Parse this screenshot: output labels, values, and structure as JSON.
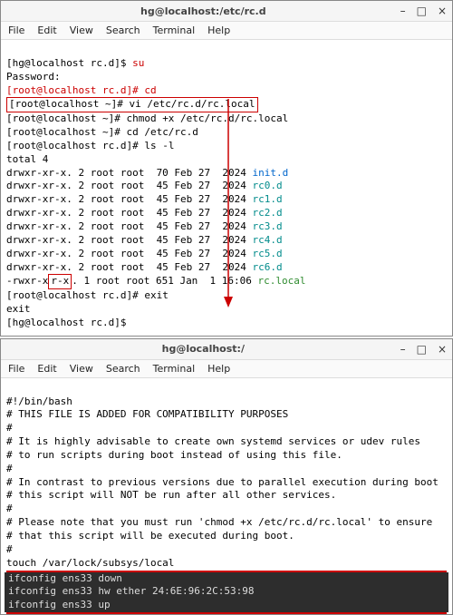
{
  "window1": {
    "title": "hg@localhost:/etc/rc.d",
    "menu": [
      "File",
      "Edit",
      "View",
      "Search",
      "Terminal",
      "Help"
    ],
    "lines": {
      "p1a": "[hg@localhost rc.d]$ ",
      "p1b": "su",
      "p2": "Password:",
      "p3a": "[root@localhost rc.d]# ",
      "p3b": "cd",
      "p4a": "[root@localhost ~]# ",
      "p4b": "vi /etc/rc.d/rc.local",
      "p5a": "[root@localhost ~]# ",
      "p5b": "chmod +x /etc/rc.d/rc.local",
      "p6a": "[root@localhost ~]# ",
      "p6b": "cd /etc/rc.d",
      "p7a": "[root@localhost rc.d]# ",
      "p7b": "ls -l",
      "total": "total 4",
      "r0a": "drwxr-xr-x. 2 root root  70 Feb 27  2024 ",
      "r0b": "init.d",
      "r1a": "drwxr-xr-x. 2 root root  45 Feb 27  2024 ",
      "r1b": "rc0.d",
      "r2a": "drwxr-xr-x. 2 root root  45 Feb 27  2024 ",
      "r2b": "rc1.d",
      "r3a": "drwxr-xr-x. 2 root root  45 Feb 27  2024 ",
      "r3b": "rc2.d",
      "r4a": "drwxr-xr-x. 2 root root  45 Feb 27  2024 ",
      "r4b": "rc3.d",
      "r5a": "drwxr-xr-x. 2 root root  45 Feb 27  2024 ",
      "r5b": "rc4.d",
      "r6a": "drwxr-xr-x. 2 root root  45 Feb 27  2024 ",
      "r6b": "rc5.d",
      "r7a": "drwxr-xr-x. 2 root root  45 Feb 27  2024 ",
      "r7b": "rc6.d",
      "r8a": "-rwxr-x",
      "r8x": "r-x",
      "r8b": ". 1 root root 651 Jan  1 16:06 ",
      "r8c": "rc.local",
      "p8a": "[root@localhost rc.d]# ",
      "p8b": "exit",
      "exit": "exit",
      "p9": "[hg@localhost rc.d]$ "
    }
  },
  "window2": {
    "title": "hg@localhost:/",
    "menu": [
      "File",
      "Edit",
      "View",
      "Search",
      "Terminal",
      "Help"
    ],
    "lines": {
      "l0": "#!/bin/bash",
      "l1": "# THIS FILE IS ADDED FOR COMPATIBILITY PURPOSES",
      "l2": "#",
      "l3": "# It is highly advisable to create own systemd services or udev rules",
      "l4": "# to run scripts during boot instead of using this file.",
      "l5": "#",
      "l6": "# In contrast to previous versions due to parallel execution during boot",
      "l7": "# this script will NOT be run after all other services.",
      "l8": "#",
      "l9": "# Please note that you must run 'chmod +x /etc/rc.d/rc.local' to ensure",
      "l10": "# that this script will be executed during boot.",
      "l11": "#",
      "l12": "touch /var/lock/subsys/local",
      "h0": "ifconfig ens33 down",
      "h1": "ifconfig ens33 hw ether 24:6E:96:2C:53:98",
      "h2": "ifconfig ens33 up"
    }
  },
  "controls": {
    "min": "–",
    "max": "□",
    "close": "×"
  }
}
